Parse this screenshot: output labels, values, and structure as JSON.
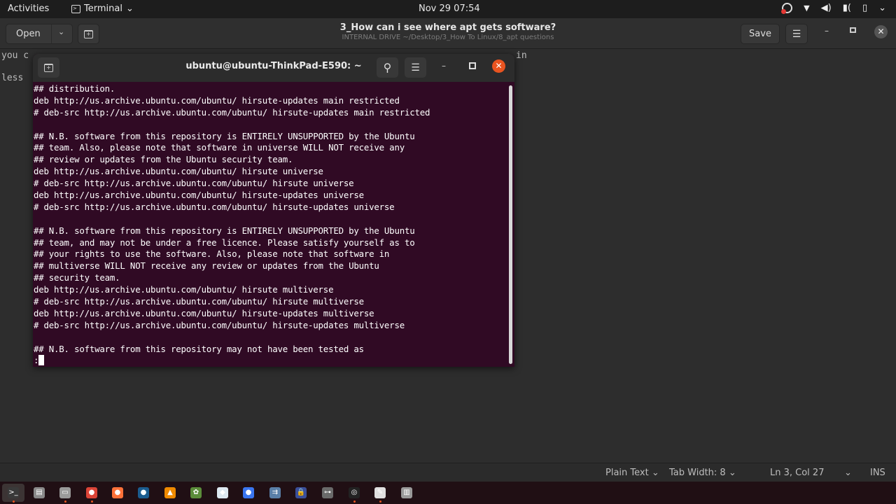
{
  "topbar": {
    "activities": "Activities",
    "app_name": "Terminal",
    "app_chevron": "⌄",
    "clock": "Nov 29  07:54",
    "tray": {
      "screen_recorder": "screen-recorder-icon",
      "wifi": "▼",
      "volume": "🔈",
      "mic": "🎤",
      "battery": "▯",
      "chevron": "⌄"
    }
  },
  "gedit": {
    "open_label": "Open",
    "open_chevron": "⌄",
    "newtab_glyph": "+",
    "title": "3_How can i see where apt gets software?",
    "subtitle": "INTERNAL DRIVE ~/Desktop/3_How To Linux/8_apt questions",
    "save_label": "Save",
    "menu_glyph": "☰",
    "min_glyph": "–",
    "close_glyph": "✕",
    "editor_visible_text": {
      "line1_left": "you c",
      "line1_right": "in",
      "line2_left": "less"
    },
    "statusbar": {
      "language": "Plain Text ⌄",
      "tab_width": "Tab Width: 8 ⌄",
      "position": "Ln 3, Col 27",
      "chevron": "⌄",
      "mode": "INS"
    }
  },
  "terminal": {
    "title": "ubuntu@ubuntu-ThinkPad-E590: ~",
    "newtab_glyph": "+",
    "search_glyph": "⚲",
    "menu_glyph": "☰",
    "min_glyph": "–",
    "close_glyph": "✕",
    "lines": [
      "## distribution.",
      "deb http://us.archive.ubuntu.com/ubuntu/ hirsute-updates main restricted",
      "# deb-src http://us.archive.ubuntu.com/ubuntu/ hirsute-updates main restricted",
      "",
      "## N.B. software from this repository is ENTIRELY UNSUPPORTED by the Ubuntu",
      "## team. Also, please note that software in universe WILL NOT receive any",
      "## review or updates from the Ubuntu security team.",
      "deb http://us.archive.ubuntu.com/ubuntu/ hirsute universe",
      "# deb-src http://us.archive.ubuntu.com/ubuntu/ hirsute universe",
      "deb http://us.archive.ubuntu.com/ubuntu/ hirsute-updates universe",
      "# deb-src http://us.archive.ubuntu.com/ubuntu/ hirsute-updates universe",
      "",
      "## N.B. software from this repository is ENTIRELY UNSUPPORTED by the Ubuntu",
      "## team, and may not be under a free licence. Please satisfy yourself as to",
      "## your rights to use the software. Also, please note that software in",
      "## multiverse WILL NOT receive any review or updates from the Ubuntu",
      "## security team.",
      "deb http://us.archive.ubuntu.com/ubuntu/ hirsute multiverse",
      "# deb-src http://us.archive.ubuntu.com/ubuntu/ hirsute multiverse",
      "deb http://us.archive.ubuntu.com/ubuntu/ hirsute-updates multiverse",
      "# deb-src http://us.archive.ubuntu.com/ubuntu/ hirsute-updates multiverse",
      "",
      "## N.B. software from this repository may not have been tested as"
    ],
    "prompt": ":"
  },
  "dock": {
    "items": [
      {
        "name": "terminal",
        "glyph": ">_",
        "color": "#3a3a3a",
        "running": true,
        "active": true
      },
      {
        "name": "files-app",
        "glyph": "▤",
        "color": "#8a8a8a",
        "running": false
      },
      {
        "name": "file-manager",
        "glyph": "▭",
        "color": "#9a9a9a",
        "running": true
      },
      {
        "name": "chrome",
        "glyph": "●",
        "color": "#db4437",
        "running": true
      },
      {
        "name": "firefox",
        "glyph": "●",
        "color": "#ff7139",
        "running": false
      },
      {
        "name": "steam",
        "glyph": "●",
        "color": "#1b5c8f",
        "running": false
      },
      {
        "name": "vlc",
        "glyph": "▲",
        "color": "#f08a00",
        "running": false
      },
      {
        "name": "game-app",
        "glyph": "✿",
        "color": "#5b8c3a",
        "running": false
      },
      {
        "name": "vs-code-like",
        "glyph": "◆",
        "color": "#dde8f0",
        "running": false
      },
      {
        "name": "signal",
        "glyph": "●",
        "color": "#3a76f0",
        "running": false
      },
      {
        "name": "pulse-app",
        "glyph": "⇉",
        "color": "#5a7fa8",
        "running": false
      },
      {
        "name": "keepass",
        "glyph": "🔒",
        "color": "#3a4f9a",
        "running": false
      },
      {
        "name": "gamepad",
        "glyph": "⊶",
        "color": "#6a6a6a",
        "running": false
      },
      {
        "name": "screen-recorder",
        "glyph": "◎",
        "color": "#222222",
        "running": true
      },
      {
        "name": "text-editor",
        "glyph": "✎",
        "color": "#e0e0e0",
        "running": true
      },
      {
        "name": "trash",
        "glyph": "▥",
        "color": "#9a9a9a",
        "running": false
      }
    ]
  },
  "colors": {
    "terminal_bg": "#300a24",
    "close_accent": "#e95420",
    "gedit_bg": "#2d2d2d"
  }
}
